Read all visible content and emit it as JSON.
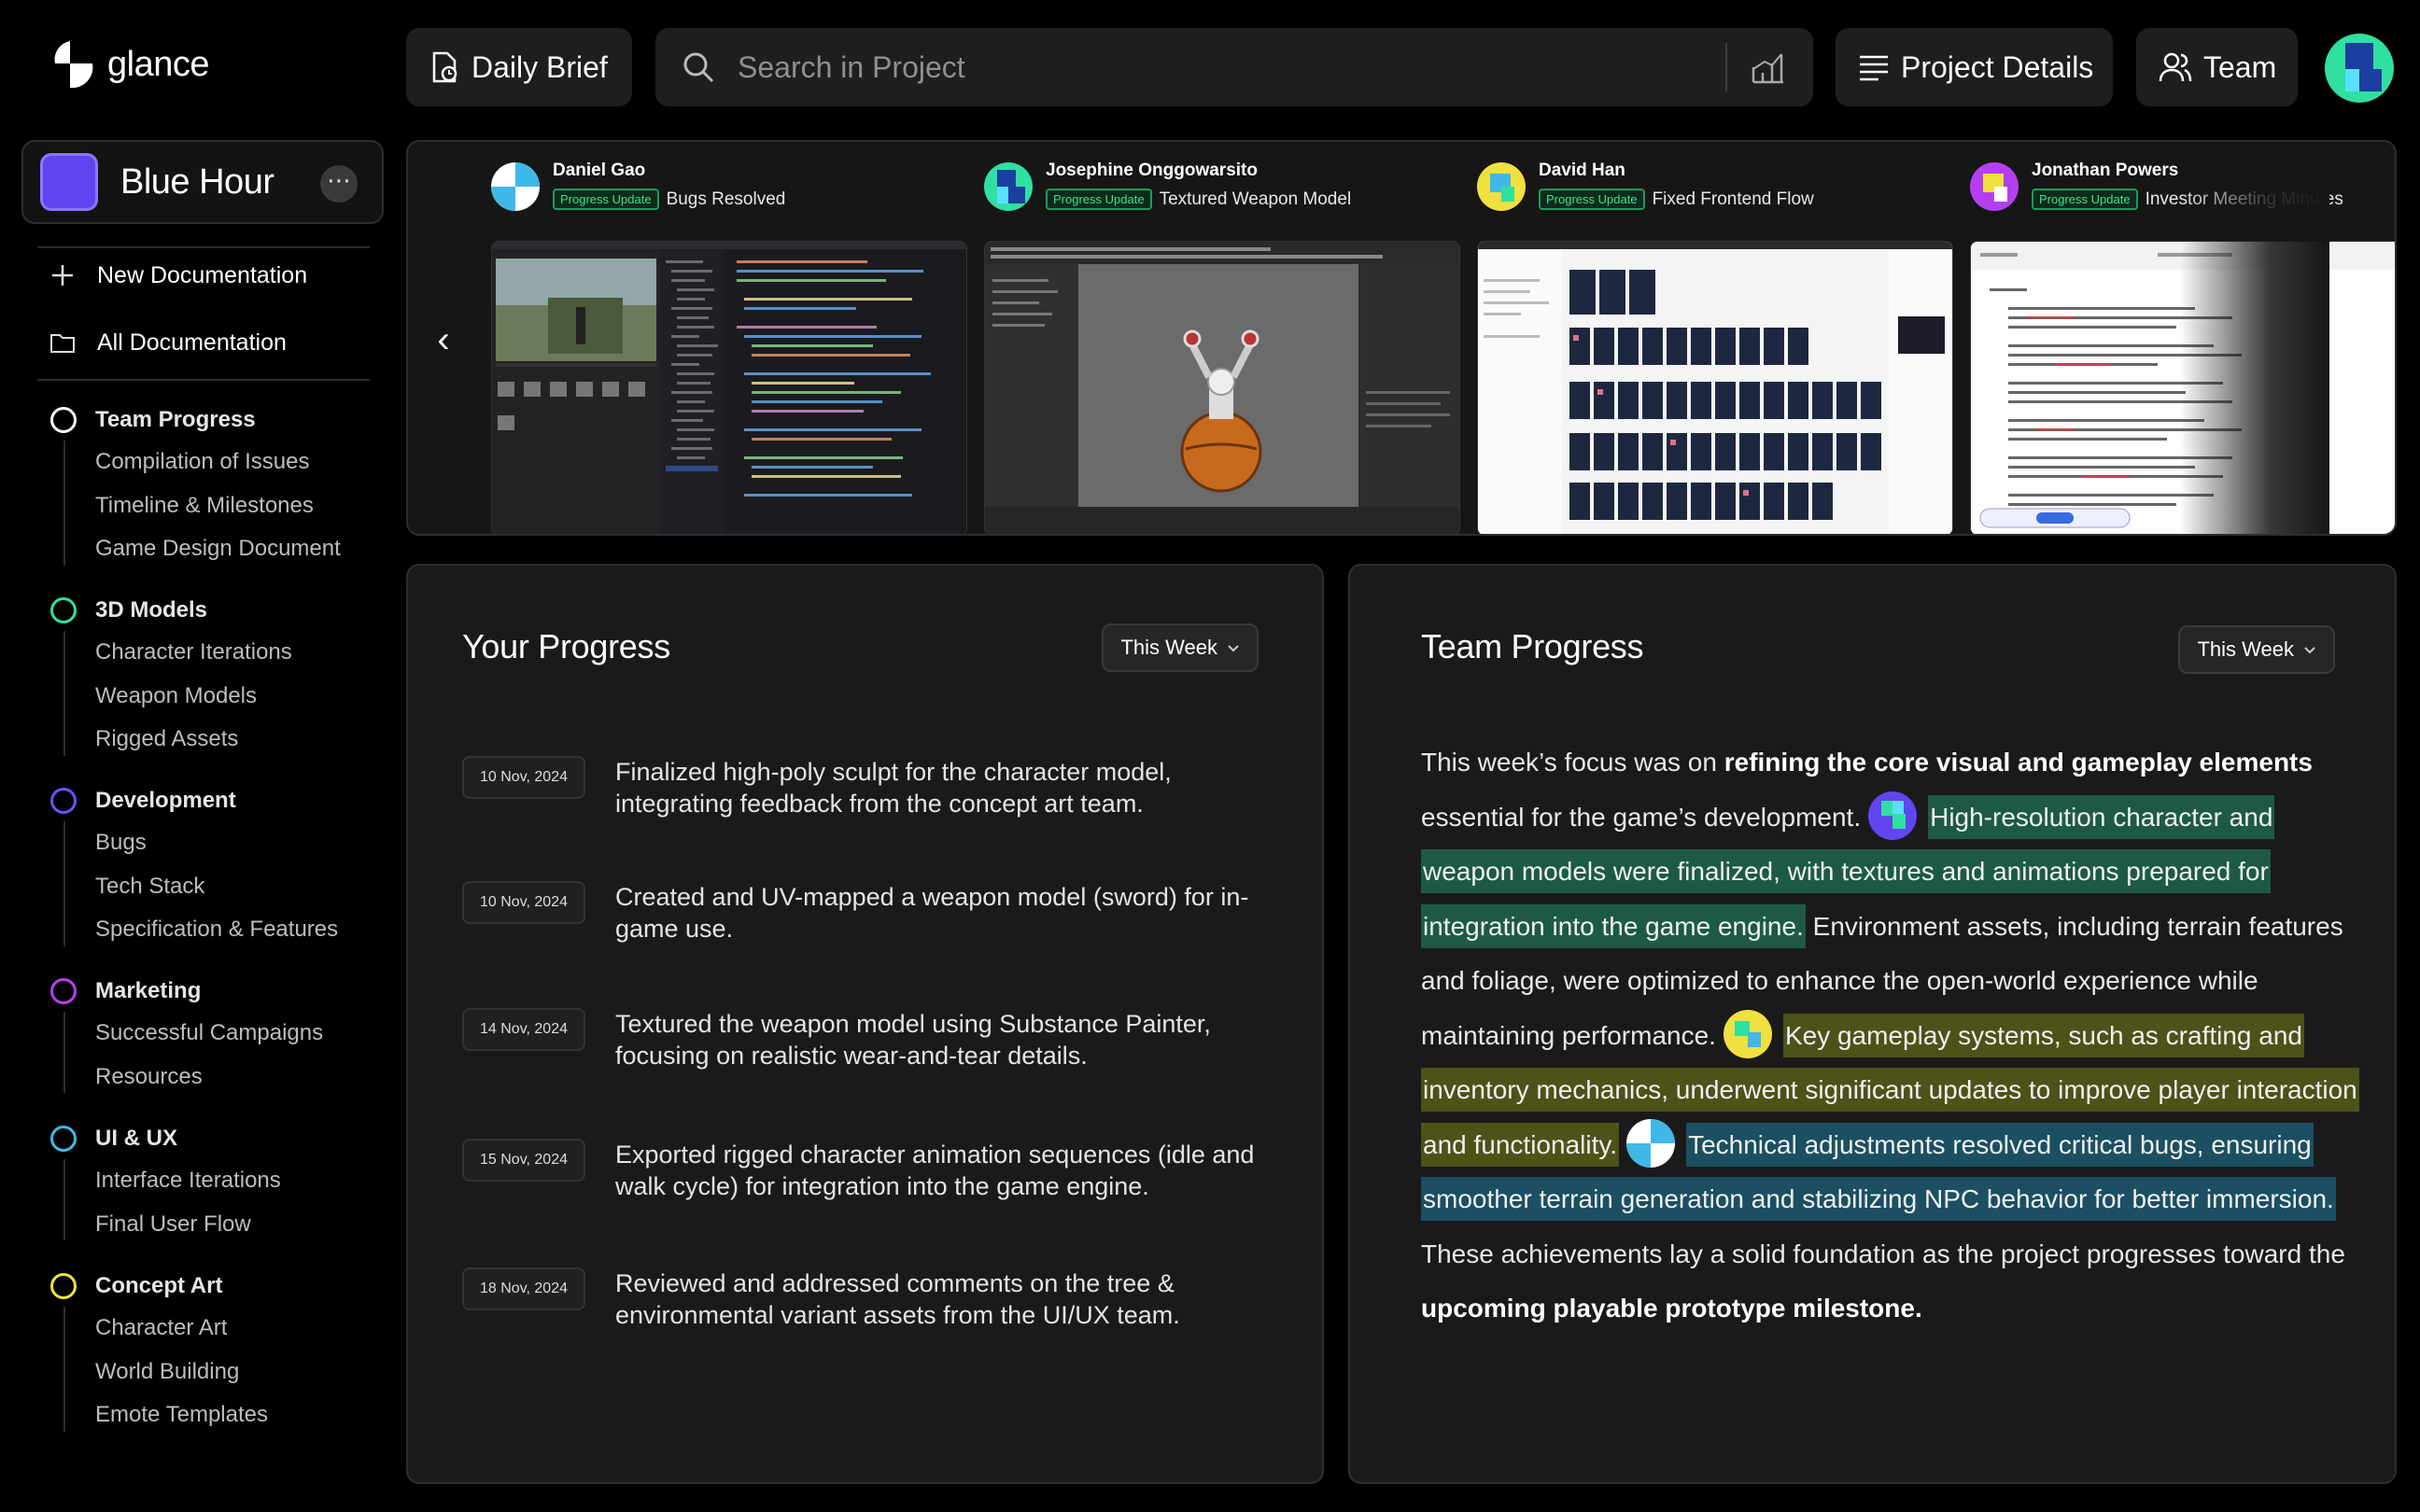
{
  "app": {
    "name": "glance"
  },
  "project": {
    "name": "Blue Hour",
    "color": "#6145f0",
    "more_label": "⋯"
  },
  "sidebar": {
    "actions": [
      {
        "label": "New Documentation",
        "icon": "plus-icon"
      },
      {
        "label": "All Documentation",
        "icon": "folder-icon"
      }
    ],
    "sections": [
      {
        "title": "Team Progress",
        "color": "#ffffff",
        "items": [
          "Compilation of Issues",
          "Timeline & Milestones",
          "Game Design Document"
        ]
      },
      {
        "title": "3D Models",
        "color": "#2fe0a0",
        "items": [
          "Character Iterations",
          "Weapon Models",
          "Rigged Assets"
        ]
      },
      {
        "title": "Development",
        "color": "#6a52f5",
        "items": [
          "Bugs",
          "Tech Stack",
          "Specification & Features"
        ]
      },
      {
        "title": "Marketing",
        "color": "#b43ff0",
        "items": [
          "Successful Campaigns",
          "Resources"
        ]
      },
      {
        "title": "UI & UX",
        "color": "#3fb8e8",
        "items": [
          "Interface Iterations",
          "Final User Flow"
        ]
      },
      {
        "title": "Concept Art",
        "color": "#f0e040",
        "items": [
          "Character Art",
          "World Building",
          "Emote Templates"
        ]
      }
    ]
  },
  "topbar": {
    "daily_brief": "Daily Brief",
    "search_placeholder": "Search in Project",
    "project_details": "Project Details",
    "team": "Team"
  },
  "updates": [
    {
      "name": "Daniel Gao",
      "badge": "Progress Update",
      "title": "Bugs Resolved"
    },
    {
      "name": "Josephine Onggowarsito",
      "badge": "Progress Update",
      "title": "Textured Weapon Model"
    },
    {
      "name": "David Han",
      "badge": "Progress Update",
      "title": "Fixed Frontend Flow"
    },
    {
      "name": "Jonathan Powers",
      "badge": "Progress Update",
      "title": "Investor Meeting Minutes"
    }
  ],
  "your_progress": {
    "title": "Your Progress",
    "filter": "This Week",
    "entries": [
      {
        "date": "10 Nov, 2024",
        "text": "Finalized high-poly sculpt for the character model, integrating feedback from the concept art team."
      },
      {
        "date": "10 Nov, 2024",
        "text": "Created and UV-mapped a weapon model (sword) for in-game use."
      },
      {
        "date": "14 Nov, 2024",
        "text": "Textured the weapon model using Substance Painter, focusing on realistic wear-and-tear details."
      },
      {
        "date": "15 Nov, 2024",
        "text": "Exported rigged character animation sequences (idle and walk cycle) for integration into the game engine."
      },
      {
        "date": "18 Nov, 2024",
        "text": "Reviewed and addressed comments on the tree & environmental variant assets from the UI/UX team."
      }
    ]
  },
  "team_progress": {
    "title": "Team Progress",
    "filter": "This Week",
    "p1": "This week’s focus was on ",
    "b1": "refining the core visual and gameplay elements",
    "p2": " essential for the game’s development.",
    "h1": "High-resolution character and weapon models were finalized, with textures and animations prepared for integration into the game engine.",
    "p3": " Environment assets, including terrain features and foliage, were optimized to enhance the open-world experience while maintaining performance.",
    "h2": "Key gameplay systems, such as crafting and inventory mechanics, underwent significant updates to improve player interaction and functionality.",
    "h3": "Technical adjustments resolved critical bugs, ensuring smoother terrain generation and stabilizing NPC behavior for better immersion.",
    "p4": " These achievements lay a solid foundation as the project progresses toward the ",
    "b2": "upcoming playable prototype milestone."
  },
  "colors": {
    "accent_green": "#2fe0a0",
    "accent_purple": "#6145f0",
    "badge_green": "#3ee08a"
  }
}
